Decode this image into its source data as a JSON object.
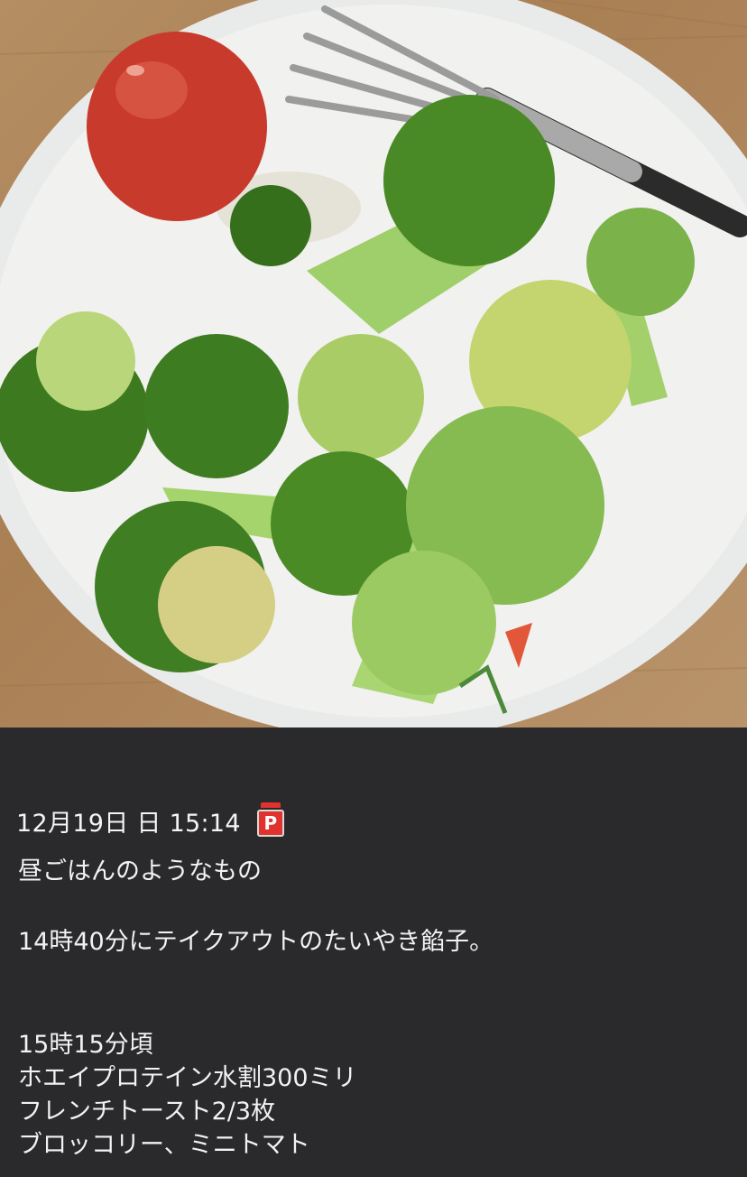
{
  "photo": {
    "description_icon": "meal-photo"
  },
  "post": {
    "date": "12月19日 日 15:14",
    "badge_letter": "P",
    "badge_color": "#e2322d",
    "lines": [
      "昼ごはんのようなもの",
      "14時40分にテイクアウトのたいやき餡子。",
      "15時15分頃",
      "ホエイプロテイン水割300ミリ",
      "フレンチトースト2/3枚",
      "ブロッコリー、ミニトマト"
    ]
  }
}
